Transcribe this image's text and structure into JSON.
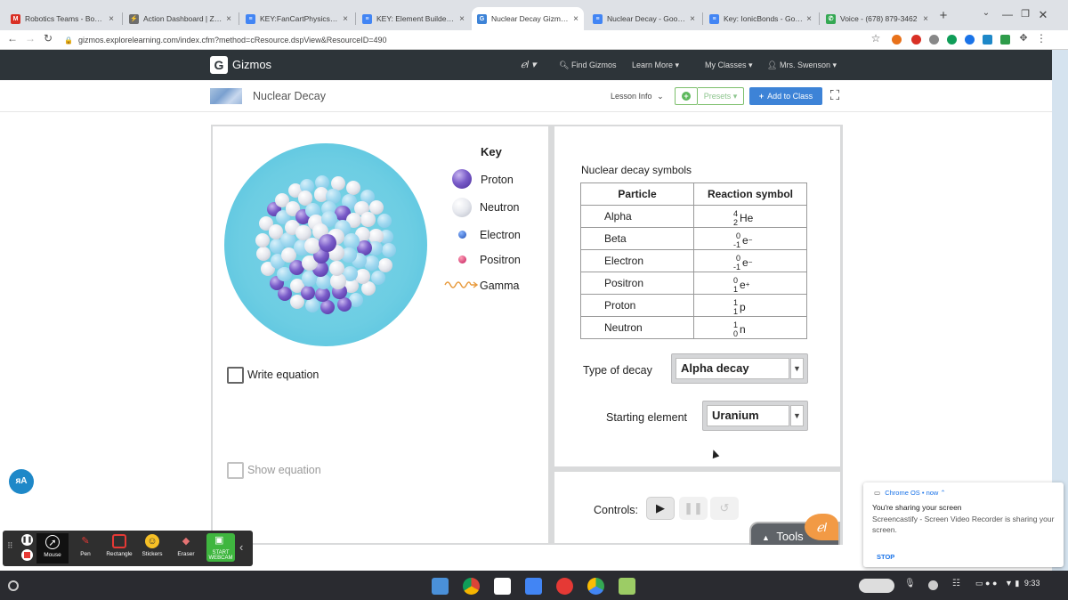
{
  "browser": {
    "tabs": [
      {
        "title": "Robotics Teams - BossBot",
        "icon_color": "#d93025",
        "icon": "M"
      },
      {
        "title": "Action Dashboard | Zapper",
        "icon_color": "#6d6d6d",
        "icon": "⚡"
      },
      {
        "title": "KEY:FanCartPhysics Part",
        "icon_color": "#4285f4",
        "icon": "≡"
      },
      {
        "title": "KEY: Element Builder - Goo",
        "icon_color": "#4285f4",
        "icon": "≡"
      },
      {
        "title": "Nuclear Decay Gizmo : Ex",
        "icon_color": "#3d83d7",
        "icon": "G"
      },
      {
        "title": "Nuclear Decay - Google Do",
        "icon_color": "#4285f4",
        "icon": "≡"
      },
      {
        "title": "Key: IonicBonds - Google D",
        "icon_color": "#4285f4",
        "icon": "≡"
      },
      {
        "title": "Voice - (678) 879-3462",
        "icon_color": "#34a853",
        "icon": "✆"
      }
    ],
    "url": "gizmos.explorelearning.com/index.cfm?method=cResource.dspView&ResourceID=490"
  },
  "site_header": {
    "logo_letter": "G",
    "logo_text": "Gizmos",
    "el_menu": "ℯl ▾",
    "find": "Find Gizmos",
    "learn_more": "Learn More ▾",
    "my_classes": "My Classes ▾",
    "user": "Mrs. Swenson ▾"
  },
  "gizmo_header": {
    "title": "Nuclear Decay",
    "lesson_info": "Lesson Info",
    "presets": "Presets ▾",
    "add_to_class": "Add to Class"
  },
  "key": {
    "title": "Key",
    "items": [
      "Proton",
      "Neutron",
      "Electron",
      "Positron",
      "Gamma"
    ]
  },
  "checkboxes": {
    "write_equation": "Write equation",
    "show_equation": "Show equation"
  },
  "symbols": {
    "title": "Nuclear decay symbols",
    "headers": [
      "Particle",
      "Reaction symbol"
    ],
    "rows": [
      {
        "particle": "Alpha",
        "mass": "4",
        "atomic": "2",
        "symbol": "He",
        "charge": ""
      },
      {
        "particle": "Beta",
        "mass": "0",
        "atomic": "-1",
        "symbol": "e",
        "charge": "−"
      },
      {
        "particle": "Electron",
        "mass": "0",
        "atomic": "-1",
        "symbol": "e",
        "charge": "−"
      },
      {
        "particle": "Positron",
        "mass": "0",
        "atomic": "1",
        "symbol": "e",
        "charge": "+"
      },
      {
        "particle": "Proton",
        "mass": "1",
        "atomic": "1",
        "symbol": "p",
        "charge": ""
      },
      {
        "particle": "Neutron",
        "mass": "1",
        "atomic": "0",
        "symbol": "n",
        "charge": ""
      }
    ]
  },
  "controls_form": {
    "type_label": "Type of decay",
    "type_value": "Alpha decay",
    "element_label": "Starting element",
    "element_value": "Uranium",
    "controls_label": "Controls:"
  },
  "tools": {
    "label": "Tools",
    "badge": "ℯl"
  },
  "screencastify": {
    "tools": [
      "Mouse",
      "Pen",
      "Rectangle",
      "Stickers",
      "Eraser"
    ],
    "webcam": "START WEBCAM"
  },
  "notification": {
    "source": "Chrome OS • now ⌃",
    "title": "You're sharing your screen",
    "body": "Screencastify - Screen Video Recorder is sharing your screen.",
    "action": "STOP"
  },
  "shelf": {
    "time": "9:33"
  },
  "colors": {
    "accent_blue": "#3d83d7",
    "header_dark": "#2d3439",
    "green": "#5cb85c"
  }
}
